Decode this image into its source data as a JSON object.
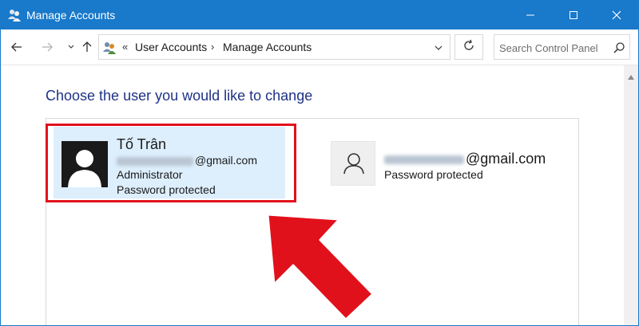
{
  "window": {
    "title": "Manage Accounts"
  },
  "address": {
    "crumbs": [
      "User Accounts",
      "Manage Accounts"
    ]
  },
  "search": {
    "placeholder": "Search Control Panel"
  },
  "main": {
    "heading": "Choose the user you would like to change",
    "accounts": [
      {
        "name": "Tố Trân",
        "email_suffix": "@gmail.com",
        "role": "Administrator",
        "status": "Password protected",
        "selected": true
      },
      {
        "email_suffix": "@gmail.com",
        "status": "Password protected",
        "selected": false
      }
    ]
  },
  "colors": {
    "titlebar": "#1979ca",
    "heading": "#1e3287",
    "selected_tile": "#ddeefd",
    "annotation_red": "#e1111b"
  },
  "icons": {
    "app": "users-icon",
    "back": "back-arrow-icon",
    "forward": "forward-arrow-icon",
    "recent": "chevron-down-icon",
    "up": "up-arrow-icon",
    "refresh": "refresh-icon",
    "search": "search-icon"
  }
}
